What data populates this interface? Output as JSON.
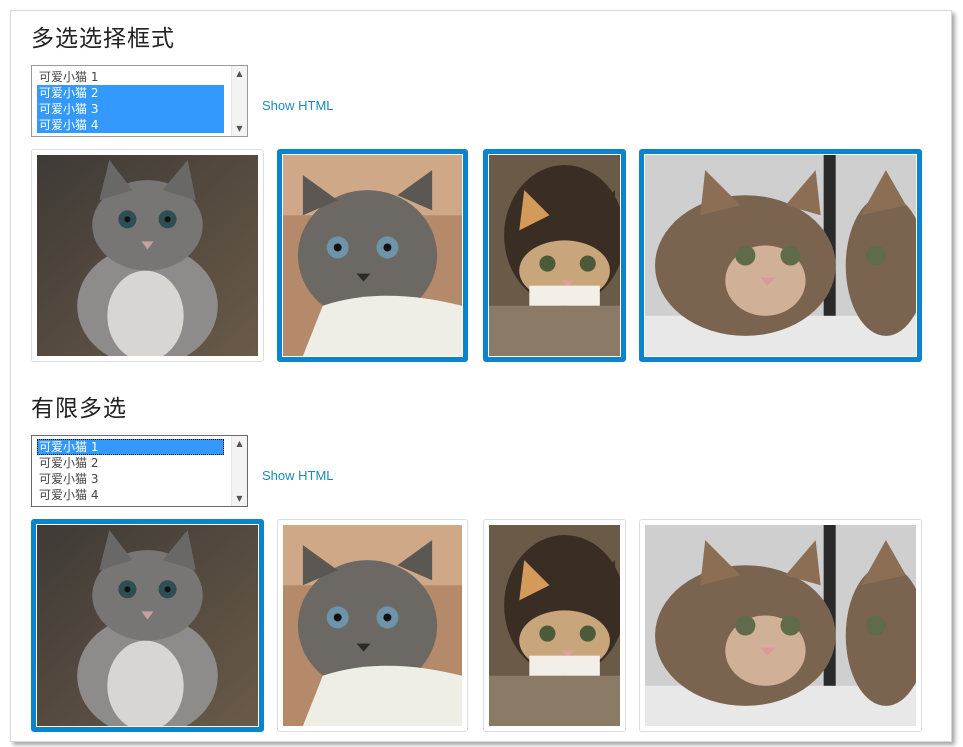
{
  "sections": [
    {
      "title": "多选选择框式",
      "options": [
        {
          "label": "可爱小猫 1",
          "selected": false
        },
        {
          "label": "可爱小猫 2",
          "selected": true
        },
        {
          "label": "可爱小猫 3",
          "selected": true
        },
        {
          "label": "可爱小猫 4",
          "selected": true
        }
      ],
      "show_html_label": "Show HTML",
      "images": [
        {
          "alt": "gray kitten",
          "selected": false
        },
        {
          "alt": "fluffy gray kitten",
          "selected": true
        },
        {
          "alt": "calico kitten",
          "selected": true
        },
        {
          "alt": "tabby kitten with mirror",
          "selected": true
        }
      ]
    },
    {
      "title": "有限多选",
      "options": [
        {
          "label": "可爱小猫 1",
          "selected": true
        },
        {
          "label": "可爱小猫 2",
          "selected": false
        },
        {
          "label": "可爱小猫 3",
          "selected": false
        },
        {
          "label": "可爱小猫 4",
          "selected": false
        }
      ],
      "show_html_label": "Show HTML",
      "images": [
        {
          "alt": "gray kitten",
          "selected": true
        },
        {
          "alt": "fluffy gray kitten",
          "selected": false
        },
        {
          "alt": "calico kitten",
          "selected": false
        },
        {
          "alt": "tabby kitten with mirror",
          "selected": false
        }
      ]
    }
  ],
  "colors": {
    "selection": "#3399ff",
    "thumb_selected_border": "#0a84cf",
    "link": "#1a8ab8"
  }
}
